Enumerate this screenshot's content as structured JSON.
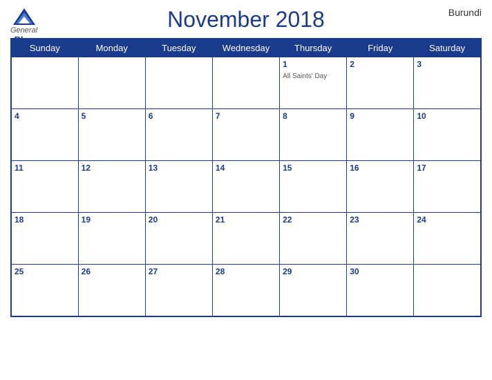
{
  "header": {
    "title": "November 2018",
    "country": "Burundi",
    "logo": {
      "general": "General",
      "blue": "Blue"
    }
  },
  "days_of_week": [
    "Sunday",
    "Monday",
    "Tuesday",
    "Wednesday",
    "Thursday",
    "Friday",
    "Saturday"
  ],
  "weeks": [
    [
      {
        "day": "",
        "holiday": ""
      },
      {
        "day": "",
        "holiday": ""
      },
      {
        "day": "",
        "holiday": ""
      },
      {
        "day": "",
        "holiday": ""
      },
      {
        "day": "1",
        "holiday": "All Saints' Day"
      },
      {
        "day": "2",
        "holiday": ""
      },
      {
        "day": "3",
        "holiday": ""
      }
    ],
    [
      {
        "day": "4",
        "holiday": ""
      },
      {
        "day": "5",
        "holiday": ""
      },
      {
        "day": "6",
        "holiday": ""
      },
      {
        "day": "7",
        "holiday": ""
      },
      {
        "day": "8",
        "holiday": ""
      },
      {
        "day": "9",
        "holiday": ""
      },
      {
        "day": "10",
        "holiday": ""
      }
    ],
    [
      {
        "day": "11",
        "holiday": ""
      },
      {
        "day": "12",
        "holiday": ""
      },
      {
        "day": "13",
        "holiday": ""
      },
      {
        "day": "14",
        "holiday": ""
      },
      {
        "day": "15",
        "holiday": ""
      },
      {
        "day": "16",
        "holiday": ""
      },
      {
        "day": "17",
        "holiday": ""
      }
    ],
    [
      {
        "day": "18",
        "holiday": ""
      },
      {
        "day": "19",
        "holiday": ""
      },
      {
        "day": "20",
        "holiday": ""
      },
      {
        "day": "21",
        "holiday": ""
      },
      {
        "day": "22",
        "holiday": ""
      },
      {
        "day": "23",
        "holiday": ""
      },
      {
        "day": "24",
        "holiday": ""
      }
    ],
    [
      {
        "day": "25",
        "holiday": ""
      },
      {
        "day": "26",
        "holiday": ""
      },
      {
        "day": "27",
        "holiday": ""
      },
      {
        "day": "28",
        "holiday": ""
      },
      {
        "day": "29",
        "holiday": ""
      },
      {
        "day": "30",
        "holiday": ""
      },
      {
        "day": "",
        "holiday": ""
      }
    ]
  ]
}
